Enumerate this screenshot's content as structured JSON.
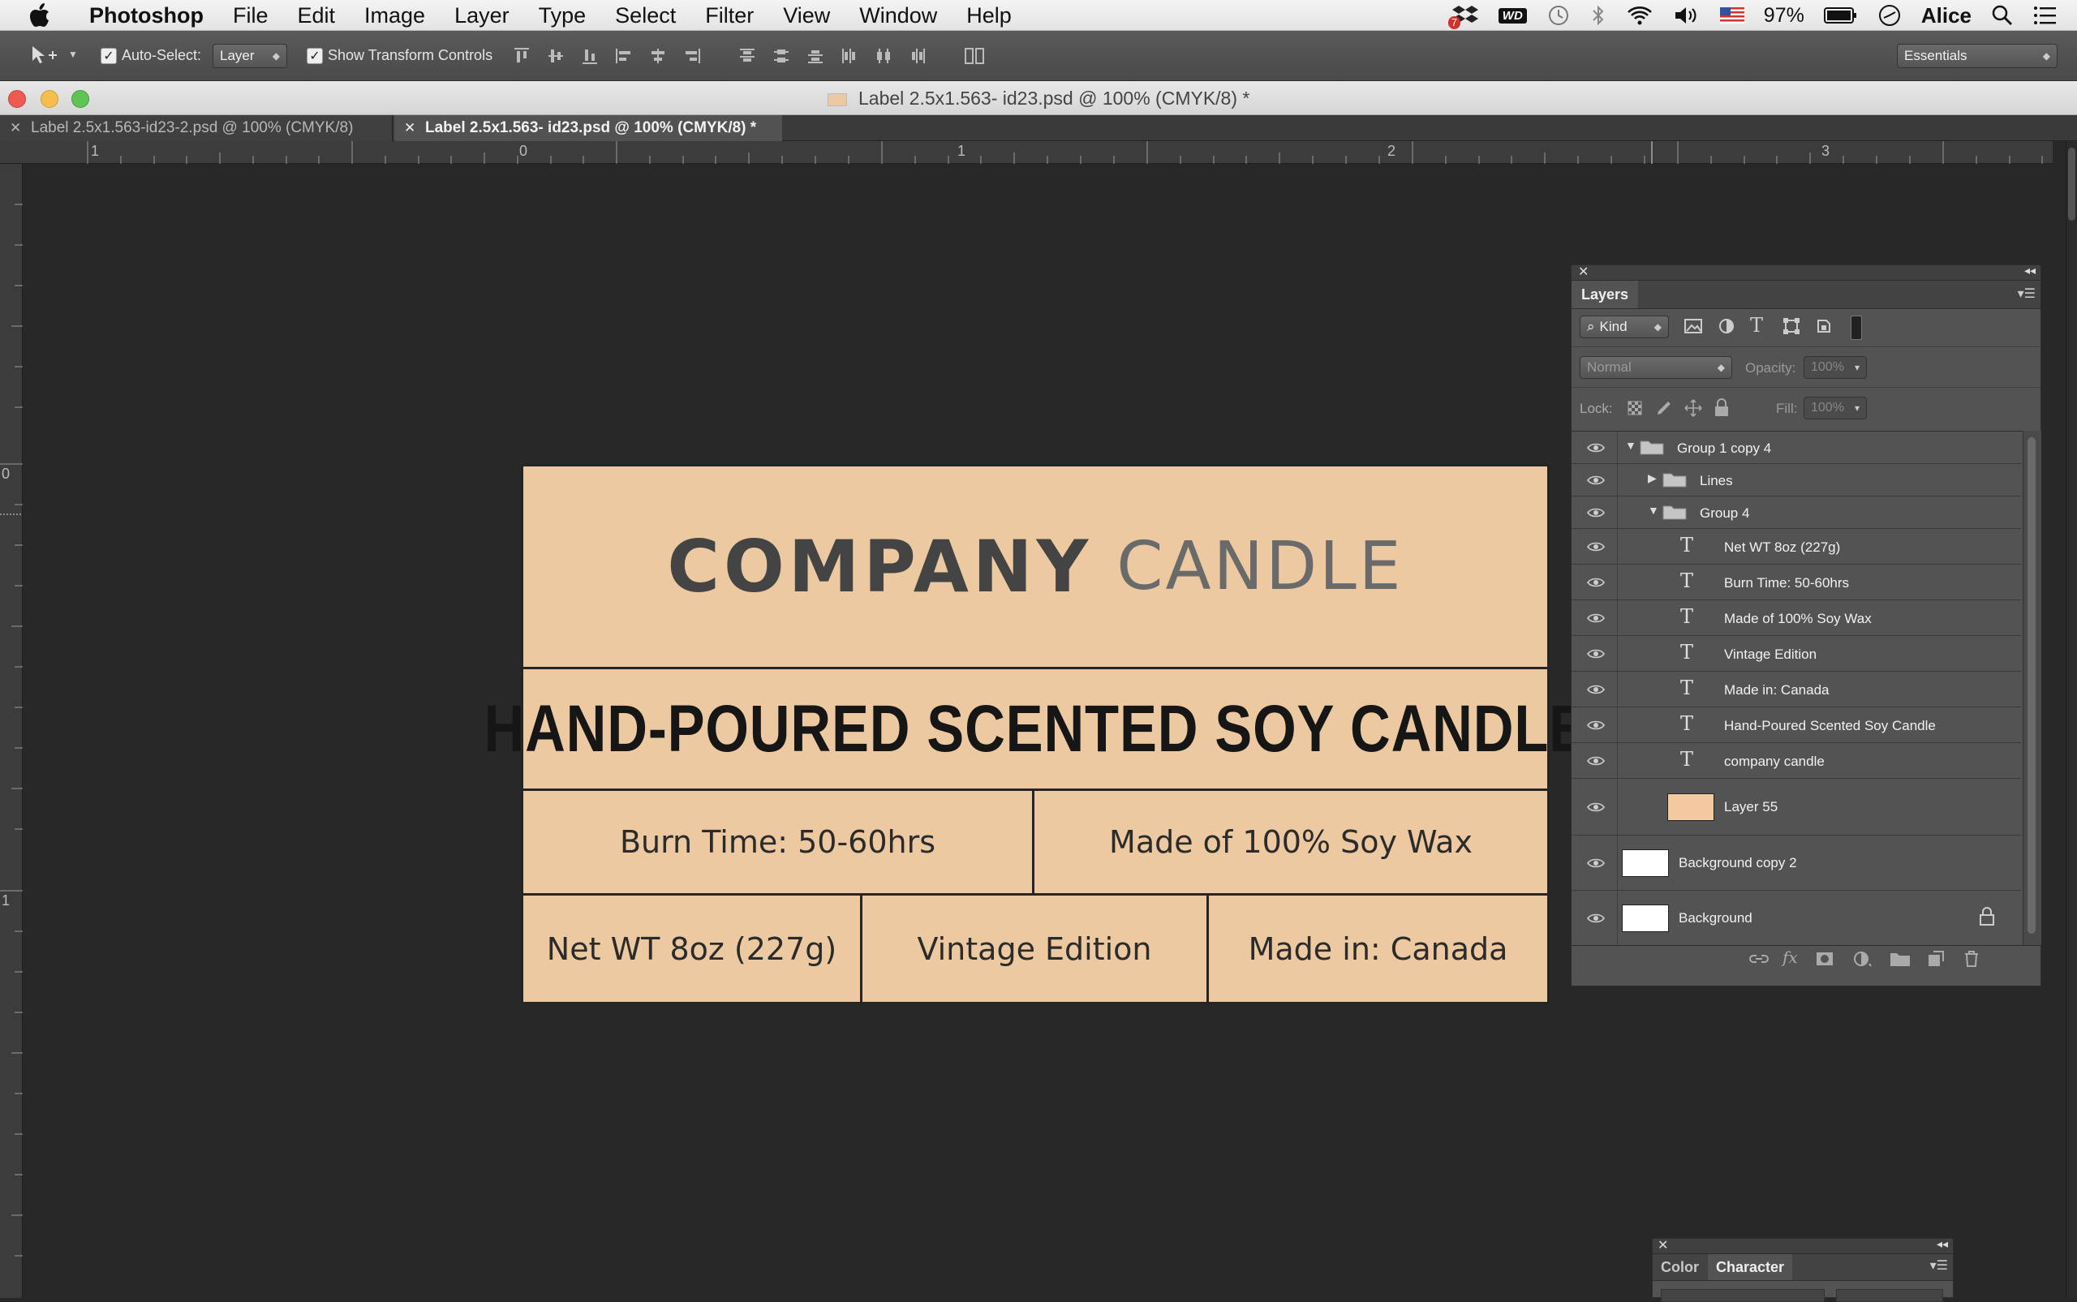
{
  "menubar": {
    "items": [
      "Photoshop",
      "File",
      "Edit",
      "Image",
      "Layer",
      "Type",
      "Select",
      "Filter",
      "View",
      "Window",
      "Help"
    ],
    "battery": "97%",
    "user": "Alice",
    "notification_count": "7",
    "wd_label": "WD"
  },
  "options": {
    "auto_select_label": "Auto-Select:",
    "auto_select_value": "Layer",
    "show_transform_label": "Show Transform Controls",
    "workspace": "Essentials"
  },
  "window": {
    "title": "Label 2.5x1.563- id23.psd @ 100% (CMYK/8) *",
    "tabs": [
      {
        "label": "Label 2.5x1.563-id23-2.psd @ 100% (CMYK/8)"
      },
      {
        "label": "Label 2.5x1.563- id23.psd @ 100% (CMYK/8) *"
      }
    ]
  },
  "rulers": {
    "horizontal": [
      "1",
      "0",
      "1",
      "2",
      "3"
    ],
    "vertical": [
      "0",
      "1"
    ]
  },
  "label": {
    "company_bold": "COMPANY",
    "company_light": "CANDLE",
    "headline": "HAND-POURED SCENTED SOY CANDLE",
    "burn_time": "Burn Time: 50-60hrs",
    "soy_wax": "Made of 100% Soy Wax",
    "net_wt": "Net WT 8oz (227g)",
    "edition": "Vintage Edition",
    "made_in": "Made in: Canada",
    "colors": {
      "background": "#ecc9a1",
      "lines": "#252525",
      "text": "#2b2b2b"
    }
  },
  "layers_panel": {
    "tab": "Layers",
    "filter_kind": "Kind",
    "blend_mode": "Normal",
    "opacity_label": "Opacity:",
    "opacity_value": "100%",
    "lock_label": "Lock:",
    "fill_label": "Fill:",
    "fill_value": "100%",
    "rows": [
      {
        "name": "Group 1 copy 4"
      },
      {
        "name": "Lines"
      },
      {
        "name": "Group 4"
      },
      {
        "name": "Net WT 8oz (227g)"
      },
      {
        "name": "Burn Time: 50-60hrs"
      },
      {
        "name": "Made of 100% Soy Wax"
      },
      {
        "name": "Vintage Edition"
      },
      {
        "name": "Made in: Canada"
      },
      {
        "name": "Hand-Poured Scented Soy Candle"
      },
      {
        "name": "company candle"
      },
      {
        "name": "Layer 55"
      },
      {
        "name": "Background copy 2"
      },
      {
        "name": "Background"
      }
    ]
  },
  "character_panel": {
    "tabs": [
      "Color",
      "Character"
    ]
  }
}
